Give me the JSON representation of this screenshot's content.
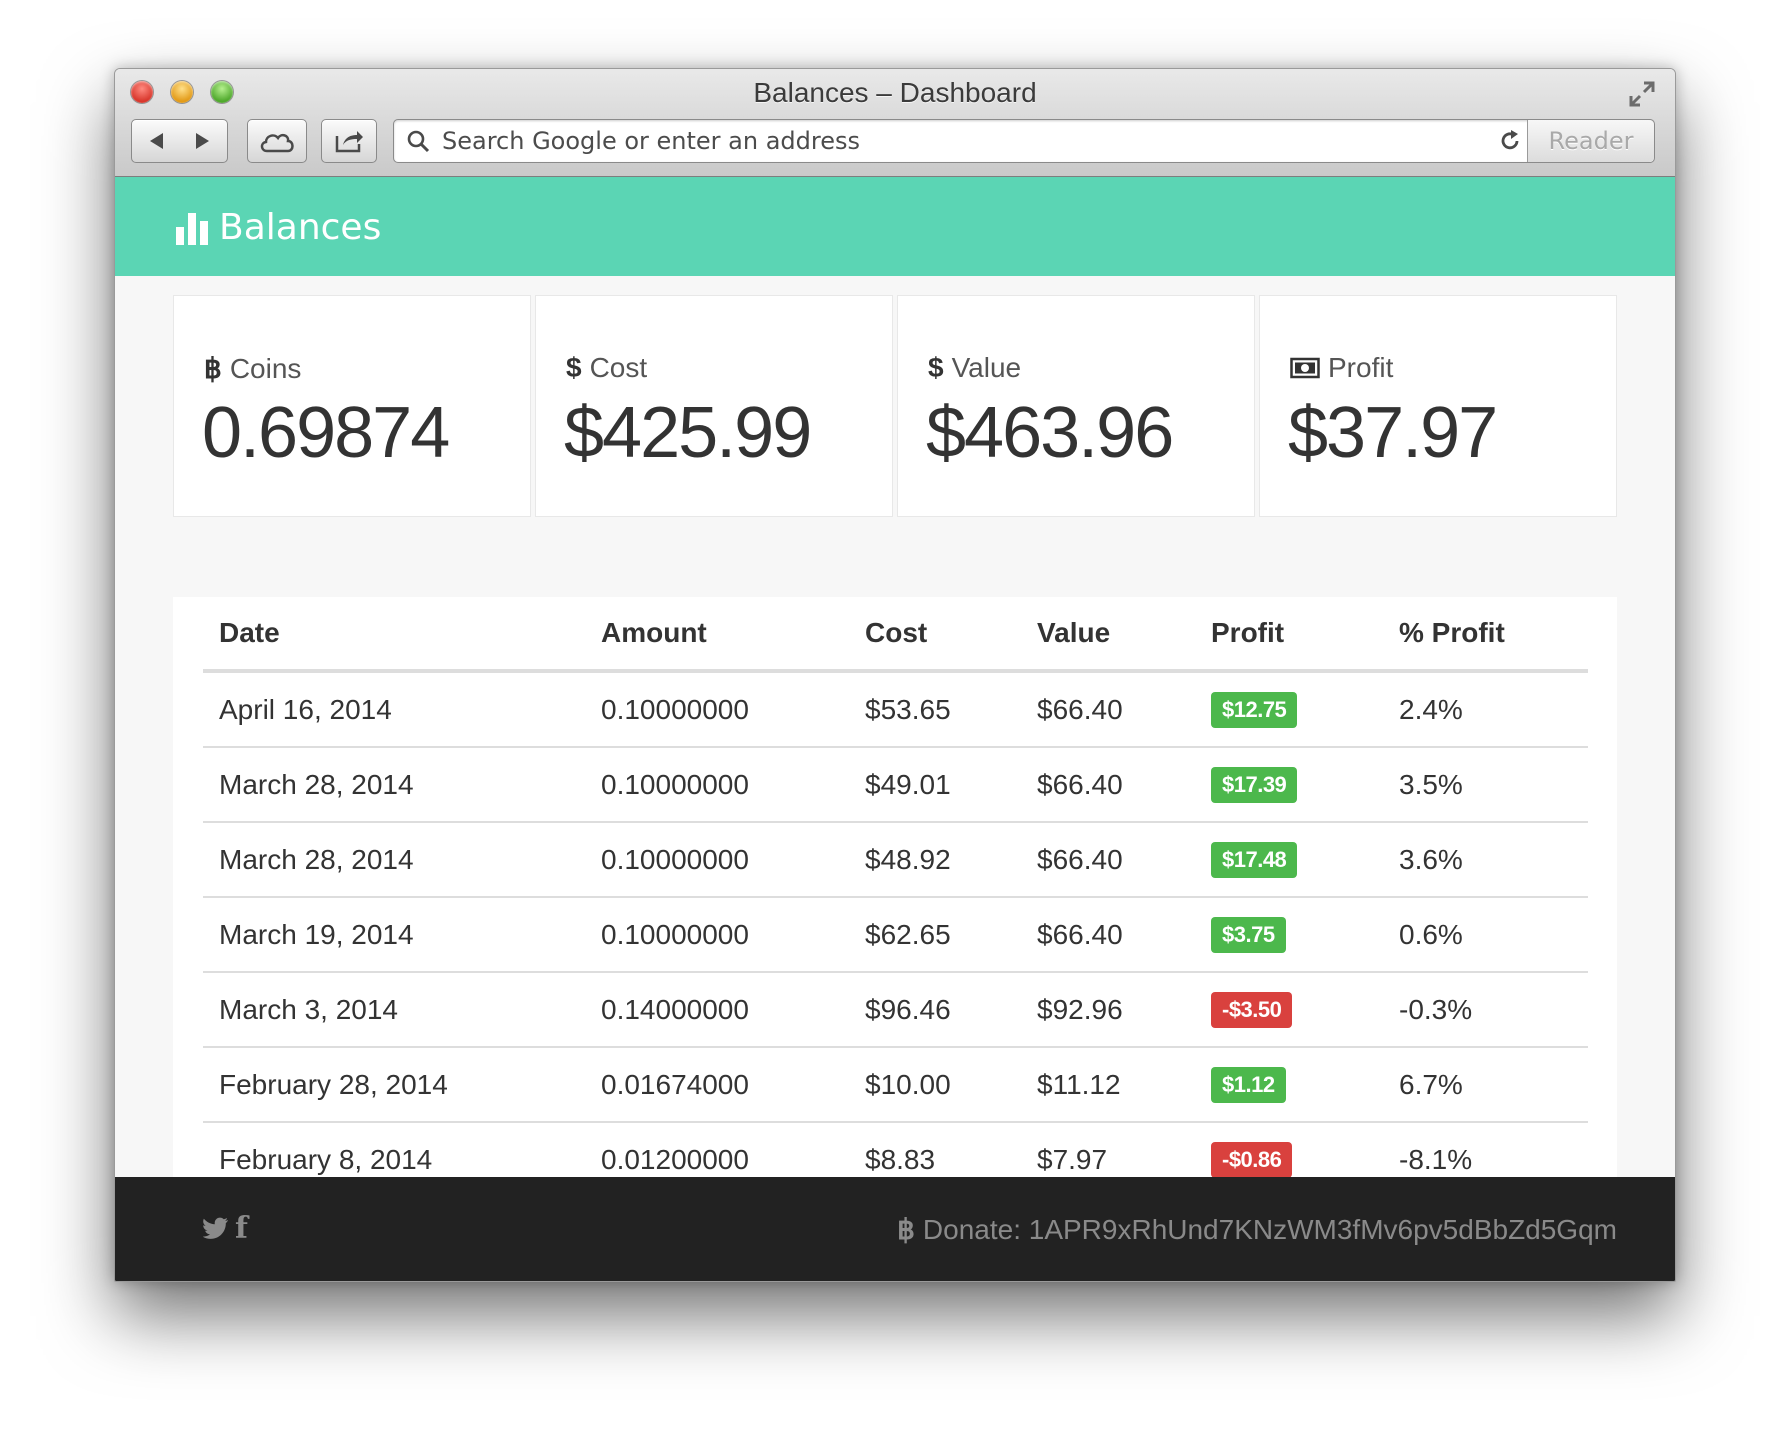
{
  "window": {
    "title": "Balances – Dashboard"
  },
  "toolbar": {
    "address_placeholder": "Search Google or enter an address",
    "reader_label": "Reader"
  },
  "header": {
    "brand": "Balances",
    "brand_icon": "bar-chart-icon"
  },
  "stats": [
    {
      "icon": "฿",
      "icon_name": "bitcoin-icon",
      "label": "Coins",
      "value": "0.69874"
    },
    {
      "icon": "$",
      "icon_name": "dollar-icon",
      "label": "Cost",
      "value": "$425.99"
    },
    {
      "icon": "$",
      "icon_name": "dollar-icon",
      "label": "Value",
      "value": "$463.96"
    },
    {
      "icon": "",
      "icon_name": "money-bill-icon",
      "label": "Profit",
      "value": "$37.97"
    }
  ],
  "table": {
    "headers": [
      "Date",
      "Amount",
      "Cost",
      "Value",
      "Profit",
      "% Profit"
    ],
    "rows": [
      {
        "date": "April 16, 2014",
        "amount": "0.10000000",
        "cost": "$53.65",
        "value": "$66.40",
        "profit": "$12.75",
        "profit_status": "pos",
        "pct": "2.4%"
      },
      {
        "date": "March 28, 2014",
        "amount": "0.10000000",
        "cost": "$49.01",
        "value": "$66.40",
        "profit": "$17.39",
        "profit_status": "pos",
        "pct": "3.5%"
      },
      {
        "date": "March 28, 2014",
        "amount": "0.10000000",
        "cost": "$48.92",
        "value": "$66.40",
        "profit": "$17.48",
        "profit_status": "pos",
        "pct": "3.6%"
      },
      {
        "date": "March 19, 2014",
        "amount": "0.10000000",
        "cost": "$62.65",
        "value": "$66.40",
        "profit": "$3.75",
        "profit_status": "pos",
        "pct": "0.6%"
      },
      {
        "date": "March 3, 2014",
        "amount": "0.14000000",
        "cost": "$96.46",
        "value": "$92.96",
        "profit": "-$3.50",
        "profit_status": "neg",
        "pct": "-0.3%"
      },
      {
        "date": "February 28, 2014",
        "amount": "0.01674000",
        "cost": "$10.00",
        "value": "$11.12",
        "profit": "$1.12",
        "profit_status": "pos",
        "pct": "6.7%"
      },
      {
        "date": "February 8, 2014",
        "amount": "0.01200000",
        "cost": "$8.83",
        "value": "$7.97",
        "profit": "-$0.86",
        "profit_status": "neg",
        "pct": "-8.1%"
      }
    ]
  },
  "footer": {
    "donate_icon": "฿",
    "donate_text": "Donate: 1APR9xRhUnd7KNzWM3fMv6pv5dBbZd5Gqm",
    "facebook_glyph": "f"
  },
  "colors": {
    "accent": "#5bd5b4",
    "positive": "#4cb84c",
    "negative": "#d9413e",
    "footer_bg": "#222222"
  }
}
